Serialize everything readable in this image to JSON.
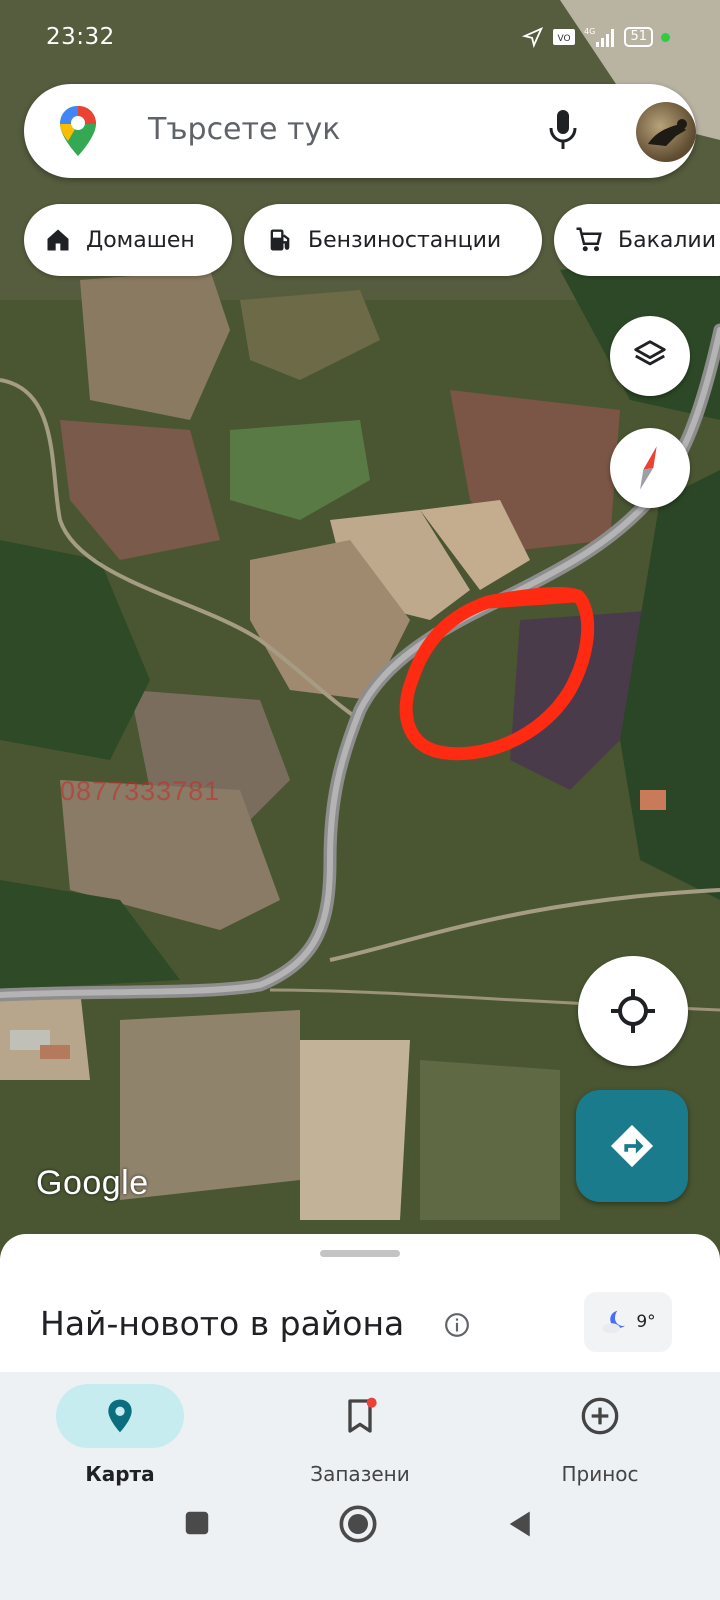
{
  "status_bar": {
    "time": "23:32",
    "battery": "51",
    "network": "4G",
    "icons": [
      "location-arrow-icon",
      "volte-icon",
      "signal-icon",
      "battery-icon",
      "green-dot"
    ]
  },
  "search": {
    "placeholder": "Търсете тук",
    "icons": [
      "google-maps-pin-logo",
      "microphone-icon",
      "account-avatar"
    ]
  },
  "chips": [
    {
      "label": "Домашен",
      "icon": "home-icon"
    },
    {
      "label": "Бензиностанции",
      "icon": "gas-station-icon"
    },
    {
      "label": "Бакалии",
      "icon": "shopping-cart-icon"
    }
  ],
  "map": {
    "type": "satellite",
    "google_logo": "Google",
    "watermark": "0877333781",
    "annotation_color": "#ff2a12",
    "controls": [
      "layers-icon",
      "compass-icon",
      "my-location-icon",
      "directions-icon"
    ]
  },
  "sheet": {
    "title": "Най-новото в района",
    "weather_temp": "9°",
    "weather_icon": "night-cloud-icon"
  },
  "nav": [
    {
      "label": "Карта",
      "icon": "map-pin-icon",
      "active": true
    },
    {
      "label": "Запазени",
      "icon": "bookmark-icon",
      "badge": true
    },
    {
      "label": "Принос",
      "icon": "add-circle-icon"
    }
  ],
  "colors": {
    "accent_teal": "#1a7b8c",
    "active_pill": "#c6ecf0",
    "maps_red": "#ea4335",
    "maps_blue": "#4285f4",
    "maps_green": "#34a853",
    "maps_yellow": "#fbbc04"
  }
}
